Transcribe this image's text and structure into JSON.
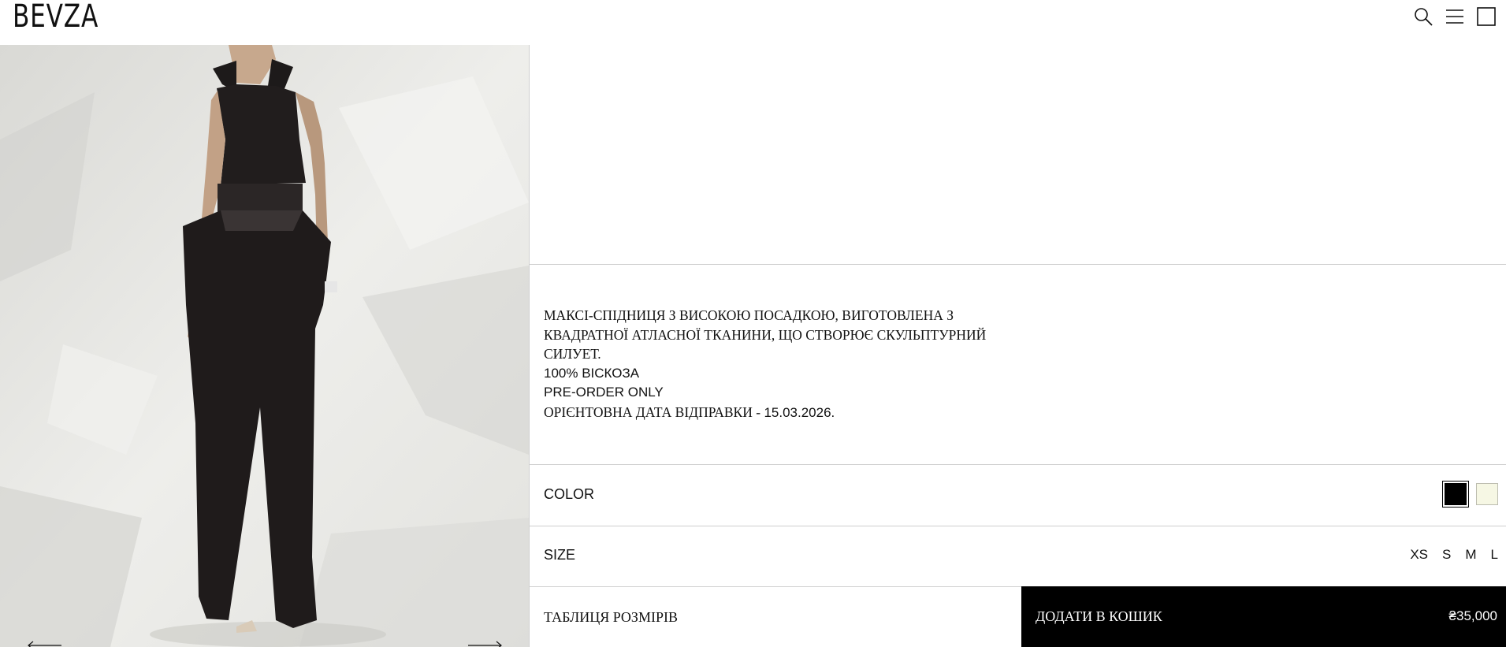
{
  "header": {
    "logo": "BEVZA",
    "icons": [
      "search-icon",
      "menu-icon",
      "cart-icon"
    ]
  },
  "gallery": {
    "prev_icon": "arrow-left-icon",
    "next_icon": "arrow-right-icon"
  },
  "product": {
    "description_lines": [
      "МАКСІ-СПІДНИЦЯ З ВИСОКОЮ ПОСАДКОЮ, ВИГОТОВЛЕНА З",
      "КВАДРАТНОЇ АТЛАСНОЇ ТКАНИНИ, ЩО СТВОРЮЄ СКУЛЬПТУРНИЙ",
      "СИЛУЕТ."
    ],
    "composition": "100% ВІСКОЗА",
    "preorder": "PRE-ORDER ONLY",
    "shipping_label": "ОРІЄНТОВНА ДАТА ВІДПРАВКИ - ",
    "shipping_date": "15.03.2026."
  },
  "color": {
    "label": "COLOR",
    "options": [
      {
        "name": "black",
        "hex": "#000000",
        "selected": true
      },
      {
        "name": "cream",
        "hex": "#F6F7E4",
        "selected": false
      }
    ]
  },
  "size": {
    "label": "SIZE",
    "options": [
      "XS",
      "S",
      "M",
      "L"
    ]
  },
  "actions": {
    "size_chart": "ТАБЛИЦЯ РОЗМІРІВ",
    "add_to_cart": "ДОДАТИ В КОШИК",
    "price": "₴35,000"
  }
}
